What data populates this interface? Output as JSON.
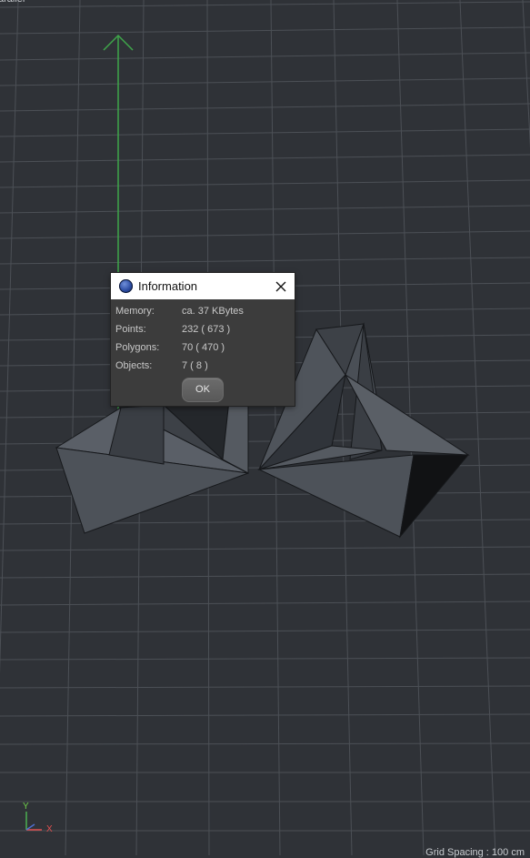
{
  "viewport": {
    "top_left_label": "arallel",
    "grid_spacing": "Grid Spacing : 100 cm",
    "axis_y_label": "Y",
    "axis_x_label": "X",
    "axis_y_color": "#4caf50",
    "axis_x_color": "#e05050"
  },
  "dialog": {
    "title": "Information",
    "icon": "cinema4d-app-icon",
    "close_icon": "close-icon",
    "rows": [
      {
        "label": "Memory:",
        "value": "ca. 37 KBytes"
      },
      {
        "label": "Points:",
        "value": "232 ( 673 )"
      },
      {
        "label": "Polygons:",
        "value": "70 ( 470 )"
      },
      {
        "label": "Objects:",
        "value": "7 ( 8 )"
      }
    ],
    "ok_label": "OK"
  }
}
